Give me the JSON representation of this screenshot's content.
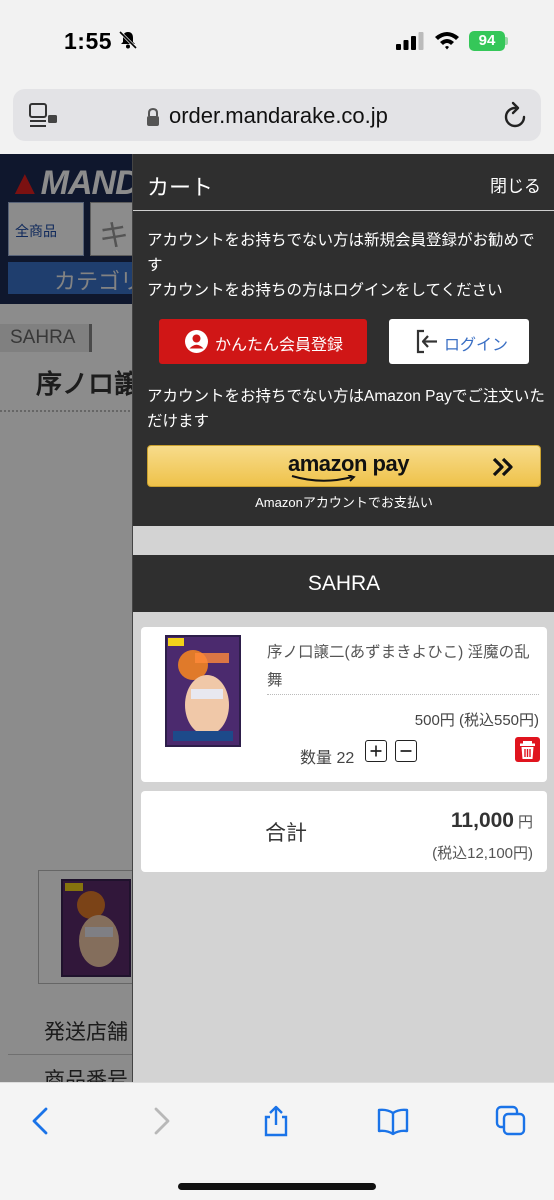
{
  "status_bar": {
    "time": "1:55",
    "battery": "94",
    "icons": [
      "bell-slash-icon",
      "cellular-signal-icon",
      "wifi-icon",
      "battery-icon"
    ]
  },
  "browser": {
    "url": "order.mandarake.co.jp",
    "icons": [
      "page-menu-icon",
      "lock-icon",
      "reload-icon"
    ]
  },
  "page": {
    "logo": "MANDA",
    "all_items": "全商品",
    "search_fragment": "キ",
    "category": "カテゴリ",
    "shop_tag": "SAHRA",
    "product_title_fragment": "序ノロ譲",
    "shipping_label_fragment": "発送店舗",
    "product_code_fragment": "商品番号"
  },
  "cart": {
    "title": "カート",
    "close": "閉じる",
    "message_register_line1": "アカウントをお持ちでない方は新規会員登録がお勧めです",
    "message_register_line2": "アカウントをお持ちの方はログインをしてください",
    "register_button": "かんたん会員登録",
    "login_button": "ログイン",
    "message_amazon": "アカウントをお持ちでない方はAmazon Payでご注文いただけます",
    "amazon_button": "amazon pay",
    "amazon_sub": "Amazonアカウントでお支払い",
    "shop_name": "SAHRA",
    "item": {
      "name": "序ノ口譲二(あずまきよひこ) 淫魔の乱舞",
      "price": "500円 (税込550円)",
      "quantity_label": "数量 22"
    },
    "total": {
      "label": "合計",
      "value": "11,000",
      "unit": "円",
      "tax": "(税込12,100円)"
    }
  },
  "toolbar": {
    "icons": [
      "back-icon",
      "forward-icon",
      "share-icon",
      "bookmarks-icon",
      "tabs-icon"
    ]
  },
  "colors": {
    "cart_dark": "#2f2f2f",
    "register_red": "#d01616",
    "login_blue": "#3a6fc4",
    "amazon_gold": "#efc24a",
    "battery_green": "#35c759",
    "ios_blue": "#1a73e8"
  }
}
